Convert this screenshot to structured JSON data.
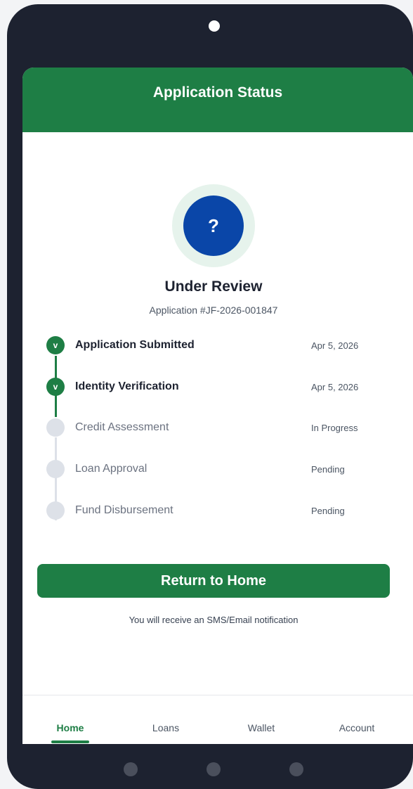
{
  "header": {
    "title": "Application Status"
  },
  "status": {
    "icon_glyph": "?",
    "icon_name": "question-icon",
    "title": "Under Review",
    "application_number": "Application #JF-2026-001847"
  },
  "timeline": [
    {
      "label": "Application Submitted",
      "date": "Apr 5, 2026",
      "state": "done",
      "mark": "v"
    },
    {
      "label": "Identity Verification",
      "date": "Apr 5, 2026",
      "state": "done",
      "mark": "v"
    },
    {
      "label": "Credit Assessment",
      "date": "In Progress",
      "state": "todo",
      "mark": ""
    },
    {
      "label": "Loan Approval",
      "date": "Pending",
      "state": "todo",
      "mark": ""
    },
    {
      "label": "Fund Disbursement",
      "date": "Pending",
      "state": "todo",
      "mark": ""
    }
  ],
  "actions": {
    "return_home_label": "Return to Home"
  },
  "notice": "You will receive an SMS/Email notification",
  "nav": {
    "items": [
      {
        "label": "Home",
        "active": true
      },
      {
        "label": "Loans",
        "active": false
      },
      {
        "label": "Wallet",
        "active": false
      },
      {
        "label": "Account",
        "active": false
      }
    ]
  },
  "colors": {
    "brand_green": "#1e7e45",
    "status_blue": "#0a46a8",
    "phone_frame": "#1d2230",
    "inactive_step": "#dde1e8"
  }
}
